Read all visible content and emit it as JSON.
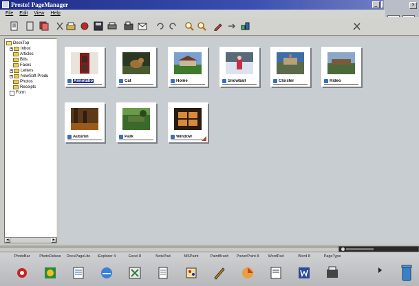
{
  "window": {
    "title": "Presto! PageManager"
  },
  "menu": [
    "File",
    "Edit",
    "View",
    "Help"
  ],
  "tree": [
    {
      "label": "DeskTop",
      "indent": 0,
      "icon": "folder-open"
    },
    {
      "label": "Inbox",
      "indent": 1,
      "icon": "inbox",
      "expander": "+"
    },
    {
      "label": "Articles",
      "indent": 2,
      "icon": "folder"
    },
    {
      "label": "Bills",
      "indent": 2,
      "icon": "folder"
    },
    {
      "label": "Faxes",
      "indent": 2,
      "icon": "folder"
    },
    {
      "label": "Letters",
      "indent": 1,
      "icon": "folder",
      "expander": "+"
    },
    {
      "label": "NewSoft Produ",
      "indent": 1,
      "icon": "folder",
      "expander": "+"
    },
    {
      "label": "Photos",
      "indent": 2,
      "icon": "folder"
    },
    {
      "label": "Receipts",
      "indent": 2,
      "icon": "folder"
    },
    {
      "label": "Form",
      "indent": 1,
      "icon": "form"
    }
  ],
  "thumbnails": [
    {
      "label": "Annotatio",
      "selected": true,
      "scene": "phonebooth"
    },
    {
      "label": "Cat",
      "selected": false,
      "scene": "cat"
    },
    {
      "label": "Home",
      "selected": false,
      "scene": "home"
    },
    {
      "label": "Snowball",
      "selected": false,
      "scene": "snowball"
    },
    {
      "label": "Cloister",
      "selected": false,
      "scene": "cloister"
    },
    {
      "label": "Rideo",
      "selected": false,
      "scene": "rideo"
    },
    {
      "label": "Autumn",
      "selected": false,
      "scene": "autumn"
    },
    {
      "label": "Park",
      "selected": false,
      "scene": "park"
    },
    {
      "label": "Window",
      "selected": false,
      "scene": "window",
      "dogear": true
    }
  ],
  "apps": [
    {
      "label": "PhotoBar",
      "icon": "photo-icon"
    },
    {
      "label": "PhotoDeluxe",
      "icon": "photodeluxe-icon"
    },
    {
      "label": "DocuPageLite",
      "icon": "docupage-icon"
    },
    {
      "label": "iExplorer 4",
      "icon": "ie-icon"
    },
    {
      "label": "Excel 8",
      "icon": "excel-icon"
    },
    {
      "label": "NotePad",
      "icon": "notepad-icon"
    },
    {
      "label": "MSPaint",
      "icon": "mspaint-icon"
    },
    {
      "label": "PaintBrush",
      "icon": "paintbrush-icon"
    },
    {
      "label": "PowerPoint 8",
      "icon": "powerpoint-icon"
    },
    {
      "label": "WordPad",
      "icon": "wordpad-icon"
    },
    {
      "label": "Word 8",
      "icon": "word-icon"
    },
    {
      "label": "PageType",
      "icon": "pagetype-icon"
    }
  ]
}
